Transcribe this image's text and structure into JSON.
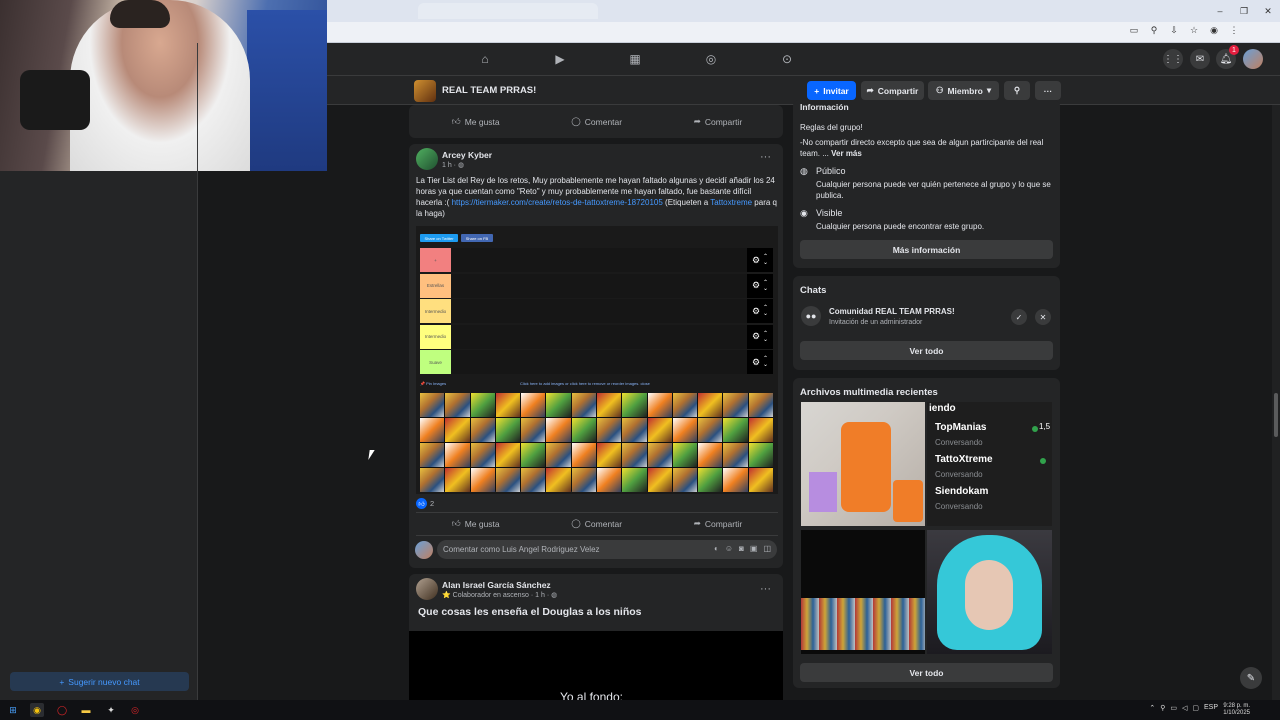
{
  "colors": {
    "accent": "#0866ff",
    "link": "#4599ff",
    "bg": "#18191a",
    "card": "#242526"
  },
  "browser": {
    "window_controls": [
      "–",
      "❐",
      "✕"
    ],
    "icons": [
      "cast-icon",
      "zoom-icon",
      "download-icon",
      "star-icon",
      "profile-icon",
      "menu-icon"
    ]
  },
  "topnav": {
    "notification_count": "1"
  },
  "group": {
    "name": "REAL TEAM PRRAS!",
    "invite_label": "Invitar",
    "share_label": "Compartir",
    "member_label": "Miembro",
    "more_label": "···"
  },
  "post_actions": {
    "like": "Me gusta",
    "comment": "Comentar",
    "share": "Compartir"
  },
  "post1": {
    "author": "Arcey Kyber",
    "time": "1 h · ",
    "text_1": "La Tier List del Rey de los retos, Muy probablemente me hayan faltado algunas y decidí añadir los 24 horas ya que cuentan como \"Reto\" y muy probablemente me hayan faltado, fue bastante difícil hacerla :(",
    "link": "https://tiermaker.com/create/retos-de-tattoxtreme-18720105",
    "text_2": "(Etiqueten a",
    "tag": "Tattoxtreme",
    "text_3": "para q la haga)",
    "like_count": "2",
    "tier_list": {
      "share_twitter": "Share on Twitter",
      "share_fb": "Share on FB",
      "tiers": [
        "+",
        "Estrellas",
        "Intermedio",
        "Intermedio",
        "Suave"
      ],
      "tier_colors": [
        "#f28080",
        "#ffbf7f",
        "#ffdf7f",
        "#ffff7f",
        "#bfff7f"
      ],
      "pin_label": "📌 Pin Images",
      "hint": "Click here to add images or click here to remove or reorder images. close"
    }
  },
  "comment_box": {
    "placeholder": "Comentar como Luis Angel Rodriguez Velez"
  },
  "post2": {
    "author": "Alan Israel García Sánchez",
    "badge": "⭐ Colaborador en ascenso · 1 h · ",
    "title": "Que cosas les enseña el Douglas a los niños",
    "video_caption": "Yo al fondo:"
  },
  "sidebar": {
    "info_heading": "Información",
    "rules_title": "Reglas del grupo!",
    "rules_text": "-No compartir directo excepto que sea de algun partircipante del real team. ...",
    "see_more": "Ver más",
    "public_title": "Público",
    "public_desc": "Cualquier persona puede ver quién pertenece al grupo y lo que se publica.",
    "visible_title": "Visible",
    "visible_desc": "Cualquier persona puede encontrar este grupo.",
    "more_info": "Más información",
    "chats_title": "Chats",
    "chat_name": "Comunidad REAL TEAM PRRAS!",
    "chat_sub": "Invitación de un administrador",
    "see_all_1": "Ver todo",
    "media_title": "Archivos multimedia recientes",
    "see_all_2": "Ver todo",
    "media_stream": {
      "head": "iendo",
      "rows": [
        {
          "name": "TopManias",
          "status": "Conversando",
          "count": "1,5"
        },
        {
          "name": "TattoXtreme",
          "status": "Conversando",
          "count": ""
        },
        {
          "name": "Siendokam",
          "status": "Conversando",
          "count": ""
        }
      ]
    }
  },
  "left": {
    "suggest_chat": "Sugerir nuevo chat"
  },
  "taskbar": {
    "lang": "ESP",
    "time": "9:28 p. m.",
    "date": "1/10/2025"
  }
}
